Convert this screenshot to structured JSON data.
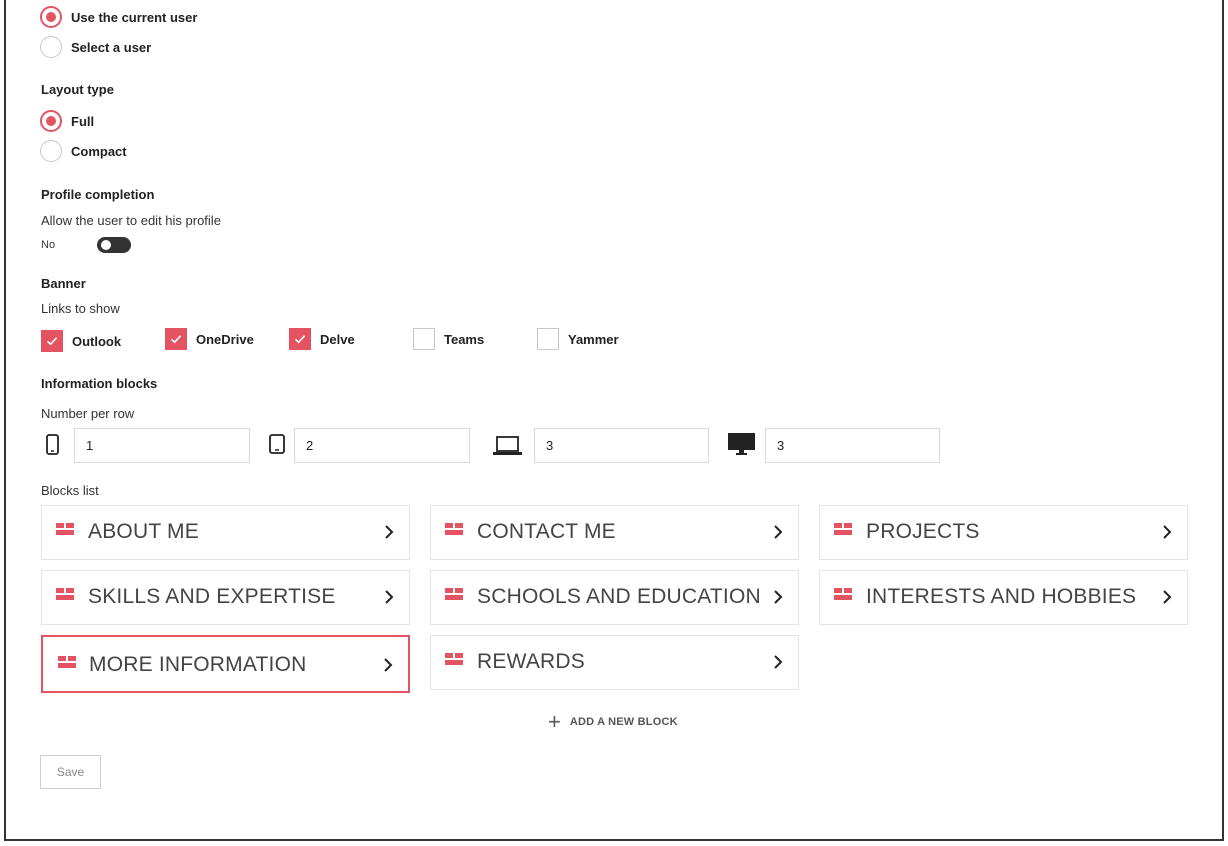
{
  "user_selection": {
    "options": [
      {
        "label": "Use the current user",
        "checked": true
      },
      {
        "label": "Select a user",
        "checked": false
      }
    ]
  },
  "layout_type": {
    "heading": "Layout type",
    "options": [
      {
        "label": "Full",
        "checked": true
      },
      {
        "label": "Compact",
        "checked": false
      }
    ]
  },
  "profile_completion": {
    "heading": "Profile completion",
    "description": "Allow the user to edit his profile",
    "toggle_label": "No",
    "toggle_on": false
  },
  "banner": {
    "heading": "Banner",
    "subheading": "Links to show",
    "links": [
      {
        "label": "Outlook",
        "checked": true
      },
      {
        "label": "OneDrive",
        "checked": true
      },
      {
        "label": "Delve",
        "checked": true
      },
      {
        "label": "Teams",
        "checked": false
      },
      {
        "label": "Yammer",
        "checked": false
      }
    ]
  },
  "information_blocks": {
    "heading": "Information blocks",
    "number_per_row_label": "Number per row",
    "per_row": [
      {
        "device": "phone-icon",
        "value": "1"
      },
      {
        "device": "tablet-icon",
        "value": "2"
      },
      {
        "device": "laptop-icon",
        "value": "3"
      },
      {
        "device": "desktop-icon",
        "value": "3"
      }
    ],
    "blocks_list_label": "Blocks list",
    "blocks": [
      {
        "title": "ABOUT ME"
      },
      {
        "title": "CONTACT ME"
      },
      {
        "title": "PROJECTS"
      },
      {
        "title": "SKILLS AND EXPERTISE"
      },
      {
        "title": "SCHOOLS AND EDUCATION"
      },
      {
        "title": "INTERESTS AND HOBBIES"
      },
      {
        "title": "MORE INFORMATION",
        "selected": true
      },
      {
        "title": "REWARDS"
      }
    ],
    "add_block_label": "ADD A NEW BLOCK"
  },
  "save_label": "Save",
  "colors": {
    "accent": "#e35361",
    "text": "#222222",
    "border": "#e4e4e4"
  }
}
